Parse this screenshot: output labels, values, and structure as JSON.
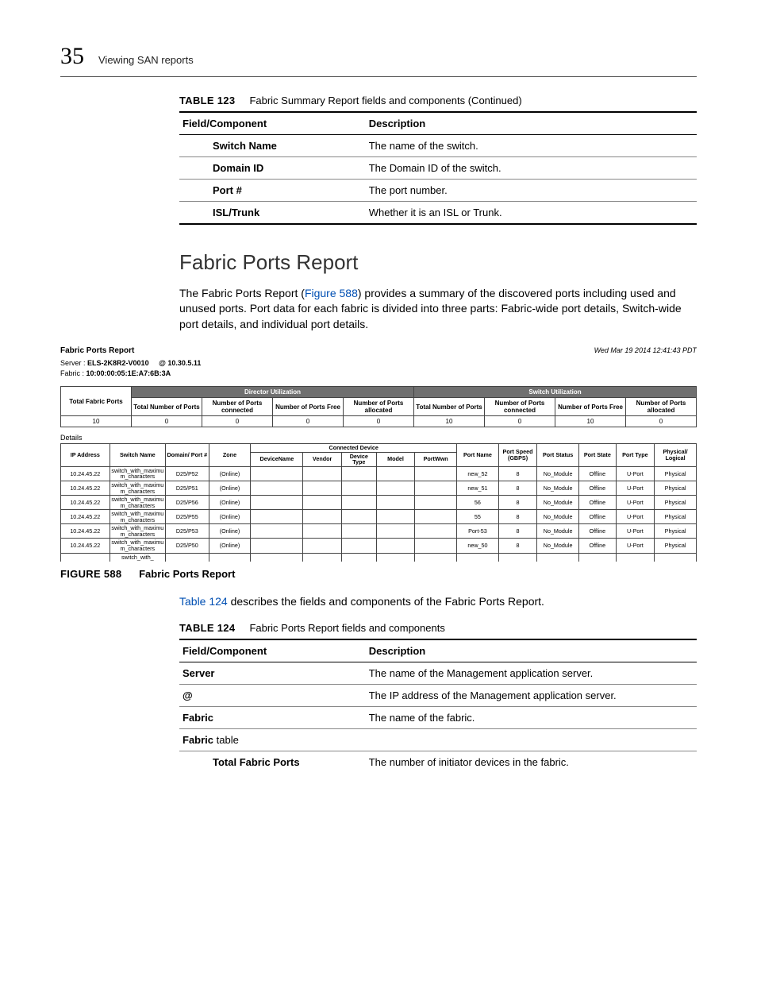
{
  "header": {
    "pageNumber": "35",
    "breadcrumb": "Viewing SAN reports"
  },
  "table123": {
    "captionLabel": "TABLE 123",
    "captionText": "Fabric Summary Report fields and components (Continued)",
    "colA": "Field/Component",
    "colB": "Description",
    "rows": [
      {
        "a": "Switch Name",
        "b": "The name of the switch."
      },
      {
        "a": "Domain ID",
        "b": "The Domain ID of the switch."
      },
      {
        "a": "Port #",
        "b": "The port number."
      },
      {
        "a": "ISL/Trunk",
        "b": "Whether it is an ISL or Trunk."
      }
    ]
  },
  "section": {
    "title": "Fabric Ports Report",
    "body_a": "The Fabric Ports Report (",
    "body_link": "Figure 588",
    "body_b": ") provides a summary of the discovered ports including used and unused ports. Port data for each fabric is divided into three parts: Fabric-wide port details, Switch-wide port details, and individual port details."
  },
  "report": {
    "title": "Fabric Ports Report",
    "date": "Wed Mar 19 2014 12:41:43 PDT",
    "server_label": "Server :",
    "server_name": "ELS-2K8R2-V0010",
    "server_at": "@ 10.30.5.11",
    "fabric_label": "Fabric  :",
    "fabric_value": "10:00:00:05:1E:A7:6B:3A",
    "grp_director": "Director Utilization",
    "grp_switch": "Switch Utilization",
    "hdr": {
      "tfp": "Total Fabric Ports",
      "tnp": "Total Number of Ports",
      "npc": "Number of Ports connected",
      "npf": "Number of Ports Free",
      "npa": "Number of Ports allocated"
    },
    "vals": {
      "c0": "10",
      "c1": "0",
      "c2": "0",
      "c3": "0",
      "c4": "0",
      "c5": "10",
      "c6": "0",
      "c7": "10",
      "c8": "0"
    },
    "details_label": "Details",
    "det_hdr": {
      "ip": "IP Address",
      "sw": "Switch Name",
      "dp": "Domain/ Port #",
      "zone": "Zone",
      "cd": "Connected Device",
      "dn": "DeviceName",
      "vendor": "Vendor",
      "dt": "Device Type",
      "model": "Model",
      "pw": "PortWwn",
      "pn": "Port Name",
      "ps": "Port Speed (GBPS)",
      "pst": "Port Status",
      "pstate": "Port State",
      "ptype": "Port Type",
      "phys": "Physical/ Logical"
    },
    "det_rows": [
      {
        "ip": "10.24.45.22",
        "sw": "switch_with_maximum_characters",
        "dp": "D25/P52",
        "zone": "(Online)",
        "pn": "new_52",
        "ps": "8",
        "pst": "No_Module",
        "pstate": "Offline",
        "ptype": "U-Port",
        "phys": "Physical"
      },
      {
        "ip": "10.24.45.22",
        "sw": "switch_with_maximum_characters",
        "dp": "D25/P51",
        "zone": "(Online)",
        "pn": "new_51",
        "ps": "8",
        "pst": "No_Module",
        "pstate": "Offline",
        "ptype": "U-Port",
        "phys": "Physical"
      },
      {
        "ip": "10.24.45.22",
        "sw": "switch_with_maximum_characters",
        "dp": "D25/P56",
        "zone": "(Online)",
        "pn": "56",
        "ps": "8",
        "pst": "No_Module",
        "pstate": "Offline",
        "ptype": "U-Port",
        "phys": "Physical"
      },
      {
        "ip": "10.24.45.22",
        "sw": "switch_with_maximum_characters",
        "dp": "D25/P55",
        "zone": "(Online)",
        "pn": "55",
        "ps": "8",
        "pst": "No_Module",
        "pstate": "Offline",
        "ptype": "U-Port",
        "phys": "Physical"
      },
      {
        "ip": "10.24.45.22",
        "sw": "switch_with_maximum_characters",
        "dp": "D25/P53",
        "zone": "(Online)",
        "pn": "Port-53",
        "ps": "8",
        "pst": "No_Module",
        "pstate": "Offline",
        "ptype": "U-Port",
        "phys": "Physical"
      },
      {
        "ip": "10.24.45.22",
        "sw": "switch_with_maximum_characters",
        "dp": "D25/P50",
        "zone": "(Online)",
        "pn": "new_50",
        "ps": "8",
        "pst": "No_Module",
        "pstate": "Offline",
        "ptype": "U-Port",
        "phys": "Physical"
      }
    ],
    "cut_row_sw": "switch_with_"
  },
  "figure": {
    "label": "FIGURE 588",
    "text": "Fabric Ports Report"
  },
  "after_figure": {
    "link": "Table 124",
    "rest": " describes the fields and components of the Fabric Ports Report."
  },
  "table124": {
    "captionLabel": "TABLE 124",
    "captionText": "Fabric Ports Report fields and components",
    "colA": "Field/Component",
    "colB": "Description",
    "rows": [
      {
        "a": "Server",
        "b": "The name of the Management application server.",
        "bold": true
      },
      {
        "a": "@",
        "b": "The IP address of the Management application server.",
        "bold": true
      },
      {
        "a": "Fabric",
        "b": "The name of the fabric.",
        "bold": true
      },
      {
        "a": "Fabric table",
        "b": "",
        "bold_partial_a": "Fabric",
        "plain_a": " table"
      },
      {
        "a": "Total Fabric Ports",
        "b": "The number of initiator devices in the fabric.",
        "indent": true
      }
    ]
  }
}
